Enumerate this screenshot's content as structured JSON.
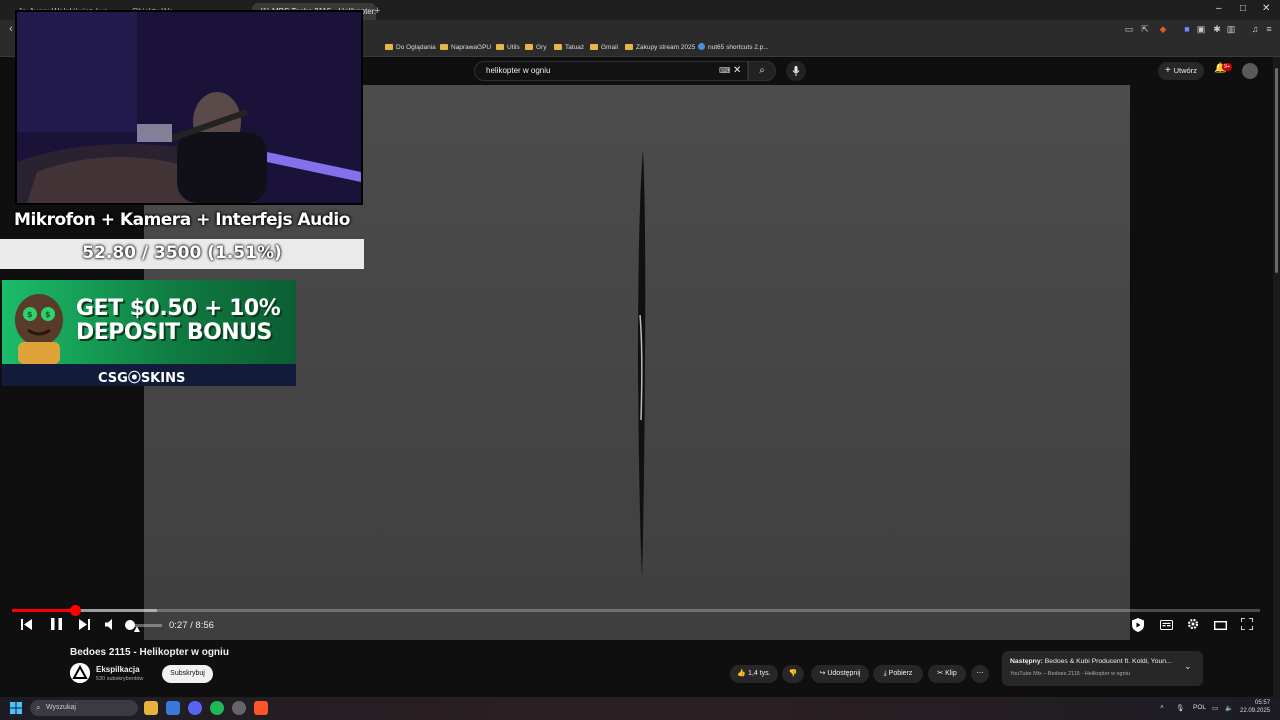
{
  "browser": {
    "tabs": [
      {
        "label": "Ja-Avery Wołakiiwicz (wa...",
        "active": false
      },
      {
        "label": "Obiekty Wa",
        "active": false
      },
      {
        "label": "(1) MBS Tasks 2115 - Helikopter...",
        "active": true
      }
    ],
    "new_tab": "+",
    "window_controls": {
      "minimize": "–",
      "maximize": "□",
      "close": "✕"
    }
  },
  "bookmarks": [
    {
      "label": "Do Oglądania",
      "type": "folder"
    },
    {
      "label": "NaprawaGPU",
      "type": "folder"
    },
    {
      "label": "Utils",
      "type": "folder"
    },
    {
      "label": "Gry",
      "type": "folder"
    },
    {
      "label": "Tatuaż",
      "type": "folder"
    },
    {
      "label": "Gmail",
      "type": "folder"
    },
    {
      "label": "Zakupy stream 2025",
      "type": "folder"
    },
    {
      "label": "nut65 shortcuts 2.p...",
      "type": "link"
    }
  ],
  "youtube": {
    "search": {
      "value": "helikopter w ogniu",
      "clear": "✕",
      "search_icon": "⌕",
      "mic_icon": "🎤",
      "keyboard_icon": "⌨"
    },
    "create_label": "Utwórz",
    "notifications_badge": "9+",
    "player": {
      "time_current": "0:27",
      "time_total": "8:56",
      "played_fraction": 0.05,
      "buffered_fraction": 0.116,
      "volume_fraction": 0.1
    },
    "video": {
      "title": "Bedoes 2115 - Helikopter w ogniu",
      "channel": "Ekspilkacja",
      "subscribers": "530 subskrybentów",
      "subscribe_label": "Subskrybuj",
      "likes": "1,4 tys.",
      "share_label": "Udostępnij",
      "download_label": "Pobierz",
      "clip_label": "Klip",
      "more": "⋯"
    },
    "next_up": {
      "prefix": "Następny:",
      "title": "Bedoes & Kubi Producent ft. Koldi, Youn...",
      "subtitle": "YouTube Mix – Bedoes 2115 - Helikopter w ogniu"
    }
  },
  "stream_overlay": {
    "title": "Mikrofon + Kamera + Interfejs Audio",
    "goal": "52.80 / 3500 (1.51%)",
    "goal_fraction": 0.0151,
    "ad": {
      "line1": "GET $0.50 + 10%",
      "line2": "DEPOSIT BONUS",
      "brand": "CSG⦿SKINS"
    }
  },
  "taskbar": {
    "search_placeholder": "Wyszukaj",
    "language": "POL",
    "time": "05:57",
    "date": "22.09.2025"
  },
  "colors": {
    "youtube_red": "#ff0000",
    "folder_yellow": "#e6b64a",
    "ad_green": "#1bbd6a"
  }
}
